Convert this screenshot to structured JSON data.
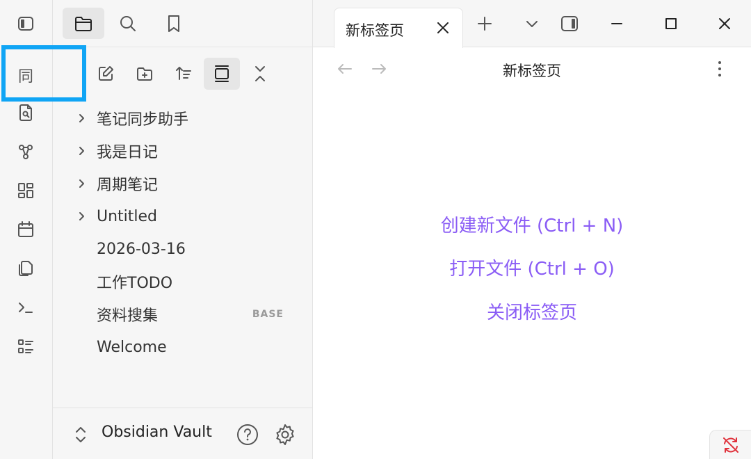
{
  "ribbon": {
    "sync_glyph": "同",
    "items": [
      {
        "name": "sync-icon"
      },
      {
        "name": "search-file-icon"
      },
      {
        "name": "graph-icon"
      },
      {
        "name": "layout-grid-icon"
      },
      {
        "name": "calendar-icon"
      },
      {
        "name": "files-icon"
      },
      {
        "name": "terminal-icon"
      },
      {
        "name": "list-icon"
      }
    ]
  },
  "sidebar": {
    "tabs": [
      {
        "name": "file-explorer-tab",
        "active": true
      },
      {
        "name": "search-tab",
        "active": false
      },
      {
        "name": "bookmarks-tab",
        "active": false
      }
    ],
    "actions": [
      {
        "name": "new-note-button"
      },
      {
        "name": "new-folder-button"
      },
      {
        "name": "sort-button"
      },
      {
        "name": "auto-reveal-button",
        "active": true
      },
      {
        "name": "collapse-all-button"
      }
    ],
    "tree": [
      {
        "label": "笔记同步助手",
        "folder": true,
        "badge": ""
      },
      {
        "label": "我是日记",
        "folder": true,
        "badge": ""
      },
      {
        "label": "周期笔记",
        "folder": true,
        "badge": ""
      },
      {
        "label": "Untitled",
        "folder": true,
        "badge": ""
      },
      {
        "label": "2026-03-16",
        "folder": false,
        "badge": ""
      },
      {
        "label": "工作TODO",
        "folder": false,
        "badge": ""
      },
      {
        "label": "资料搜集",
        "folder": false,
        "badge": "BASE"
      },
      {
        "label": "Welcome",
        "folder": false,
        "badge": ""
      }
    ],
    "vault": {
      "name": "Obsidian Vault"
    }
  },
  "main": {
    "tab": {
      "title": "新标签页"
    },
    "view": {
      "title": "新标签页"
    },
    "empty_actions": [
      {
        "label": "创建新文件 (Ctrl + N)"
      },
      {
        "label": "打开文件 (Ctrl + O)"
      },
      {
        "label": "关闭标签页"
      }
    ]
  },
  "colors": {
    "accent": "#8a5cf5",
    "highlight": "#10a5f5",
    "sync_error": "#e0323c"
  }
}
